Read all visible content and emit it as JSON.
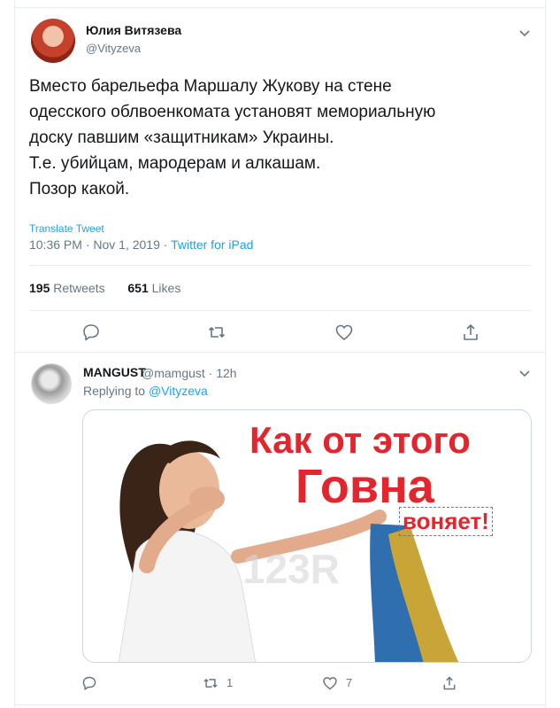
{
  "main_tweet": {
    "author_name": "Юлия Витязева",
    "author_handle": "@Vityzeva",
    "text_lines": [
      "Вместо барельефа Маршалу Жукову на стене",
      "одесского облвоенкомата установят мемориальную",
      "доску павшим «защитникам» Украины.",
      "Т.е. убийцам, мародерам и алкашам.",
      "Позор какой."
    ],
    "translate_label": "Translate Tweet",
    "timestamp": "10:36 PM · Nov 1, 2019 · ",
    "source": "Twitter for iPad",
    "retweets_count": "195",
    "retweets_label": "Retweets",
    "likes_count": "651",
    "likes_label": "Likes",
    "action_icons": [
      "reply-icon",
      "retweet-icon",
      "like-icon",
      "share-icon"
    ]
  },
  "reply_tweet": {
    "author_name": "MANGUST",
    "meta": "@mamgust · 12h",
    "replying_prefix": "Replying to ",
    "replying_handle": "@Vityzeva",
    "image_caption_1": "Как от этого",
    "image_caption_2": "Говна",
    "image_caption_3": "воняет!",
    "retweet_count": "1",
    "like_count": "7"
  },
  "colors": {
    "accent": "#1da1f2",
    "text": "#14171a",
    "secondary": "#657786",
    "border": "#e6ecf0",
    "caption_red": "#e3262d"
  }
}
